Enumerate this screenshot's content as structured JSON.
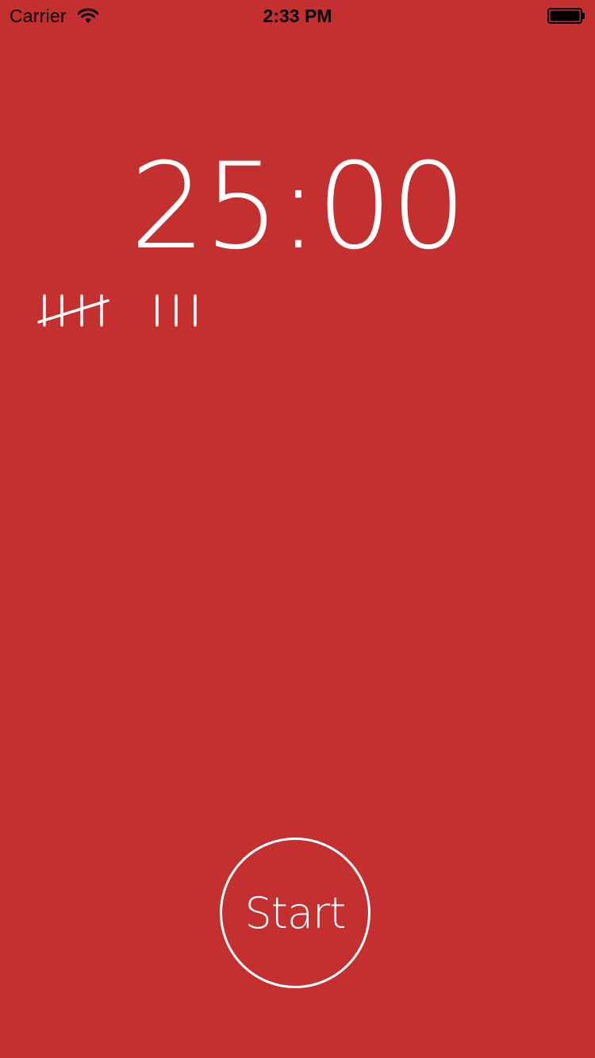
{
  "status_bar": {
    "carrier": "Carrier",
    "time": "2:33 PM",
    "wifi_icon": "wifi-icon",
    "battery_icon": "battery-icon",
    "battery_level": 1.0
  },
  "timer": {
    "display": "25:00"
  },
  "tally": {
    "completed_count": 8,
    "icon": "tally-marks-icon"
  },
  "start_button": {
    "label": "Start"
  },
  "colors": {
    "background": "#c42f2f",
    "foreground": "#ffffff",
    "status_text": "#000000"
  }
}
